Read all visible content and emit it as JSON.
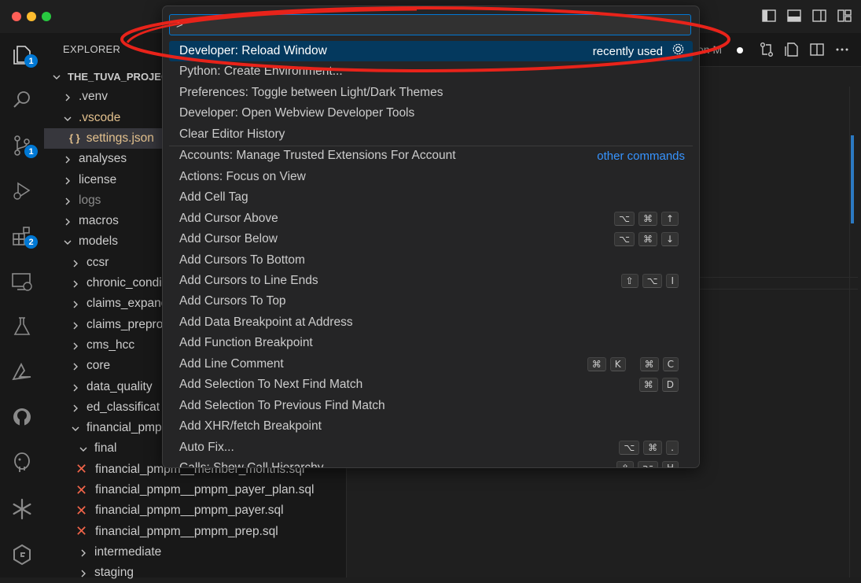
{
  "explorer": {
    "title": "EXPLORER",
    "badges": {
      "explorer": "1",
      "source_control": "1",
      "extensions": "2"
    },
    "tree": [
      {
        "label": "THE_TUVA_PROJEC",
        "chevron": "down",
        "indent": 0,
        "bold": true
      },
      {
        "label": ".venv",
        "chevron": "right",
        "indent": 1
      },
      {
        "label": ".vscode",
        "chevron": "down",
        "indent": 1,
        "color": "#e2c08d"
      },
      {
        "label": "settings.json",
        "icon": "{ }",
        "indent": 2,
        "selected": true,
        "color": "#e2c08d"
      },
      {
        "label": "analyses",
        "chevron": "right",
        "indent": 1
      },
      {
        "label": "license",
        "chevron": "right",
        "indent": 1
      },
      {
        "label": "logs",
        "chevron": "right",
        "indent": 1,
        "dim": true
      },
      {
        "label": "macros",
        "chevron": "right",
        "indent": 1
      },
      {
        "label": "models",
        "chevron": "down",
        "indent": 1
      },
      {
        "label": "ccsr",
        "chevron": "right",
        "indent": 2
      },
      {
        "label": "chronic_condi",
        "chevron": "right",
        "indent": 2
      },
      {
        "label": "claims_expand",
        "chevron": "right",
        "indent": 2
      },
      {
        "label": "claims_prepro",
        "chevron": "right",
        "indent": 2
      },
      {
        "label": "cms_hcc",
        "chevron": "right",
        "indent": 2
      },
      {
        "label": "core",
        "chevron": "right",
        "indent": 2
      },
      {
        "label": "data_quality",
        "chevron": "right",
        "indent": 2
      },
      {
        "label": "ed_classificat",
        "chevron": "right",
        "indent": 2
      },
      {
        "label": "financial_pmp",
        "chevron": "down",
        "indent": 2
      },
      {
        "label": "final",
        "chevron": "down",
        "indent": 3
      },
      {
        "label": "financial_pmpm__member_months.sql",
        "icon": "x",
        "indent": 4
      },
      {
        "label": "financial_pmpm__pmpm_payer_plan.sql",
        "icon": "x",
        "indent": 4
      },
      {
        "label": "financial_pmpm__pmpm_payer.sql",
        "icon": "x",
        "indent": 4
      },
      {
        "label": "financial_pmpm__pmpm_prep.sql",
        "icon": "x",
        "indent": 4
      },
      {
        "label": "intermediate",
        "chevron": "right",
        "indent": 3
      },
      {
        "label": "staging",
        "chevron": "right",
        "indent": 3
      }
    ]
  },
  "editor": {
    "tab_label": "on M"
  },
  "palette": {
    "input_value": ">",
    "recently_used_label": "recently used",
    "other_commands_label": "other commands",
    "recent": [
      {
        "label": "Developer: Reload Window",
        "active": true
      },
      {
        "label": "Python: Create Environment..."
      },
      {
        "label": "Preferences: Toggle between Light/Dark Themes"
      },
      {
        "label": "Developer: Open Webview Developer Tools"
      },
      {
        "label": "Clear Editor History"
      }
    ],
    "commands": [
      {
        "label": "Accounts: Manage Trusted Extensions For Account",
        "keys": []
      },
      {
        "label": "Actions: Focus on  View",
        "keys": []
      },
      {
        "label": "Add Cell Tag",
        "keys": []
      },
      {
        "label": "Add Cursor Above",
        "keys": [
          [
            "⌥",
            "⌘",
            "↑"
          ]
        ]
      },
      {
        "label": "Add Cursor Below",
        "keys": [
          [
            "⌥",
            "⌘",
            "↓"
          ]
        ]
      },
      {
        "label": "Add Cursors To Bottom",
        "keys": []
      },
      {
        "label": "Add Cursors to Line Ends",
        "keys": [
          [
            "⇧",
            "⌥",
            "I"
          ]
        ]
      },
      {
        "label": "Add Cursors To Top",
        "keys": []
      },
      {
        "label": "Add Data Breakpoint at Address",
        "keys": []
      },
      {
        "label": "Add Function Breakpoint",
        "keys": []
      },
      {
        "label": "Add Line Comment",
        "keys": [
          [
            "⌘",
            "K"
          ],
          [
            "⌘",
            "C"
          ]
        ]
      },
      {
        "label": "Add Selection To Next Find Match",
        "keys": [
          [
            "⌘",
            "D"
          ]
        ]
      },
      {
        "label": "Add Selection To Previous Find Match",
        "keys": []
      },
      {
        "label": "Add XHR/fetch Breakpoint",
        "keys": []
      },
      {
        "label": "Auto Fix...",
        "keys": [
          [
            "⌥",
            "⌘",
            "."
          ]
        ]
      },
      {
        "label": "Calls: Show Call Hierarchy",
        "keys": [
          [
            "⇧",
            "⌥",
            "H"
          ]
        ]
      }
    ]
  },
  "colors": {
    "accent": "#0078d4",
    "annotation": "#e8231a",
    "active_row": "#04395e",
    "link": "#3794ff"
  }
}
